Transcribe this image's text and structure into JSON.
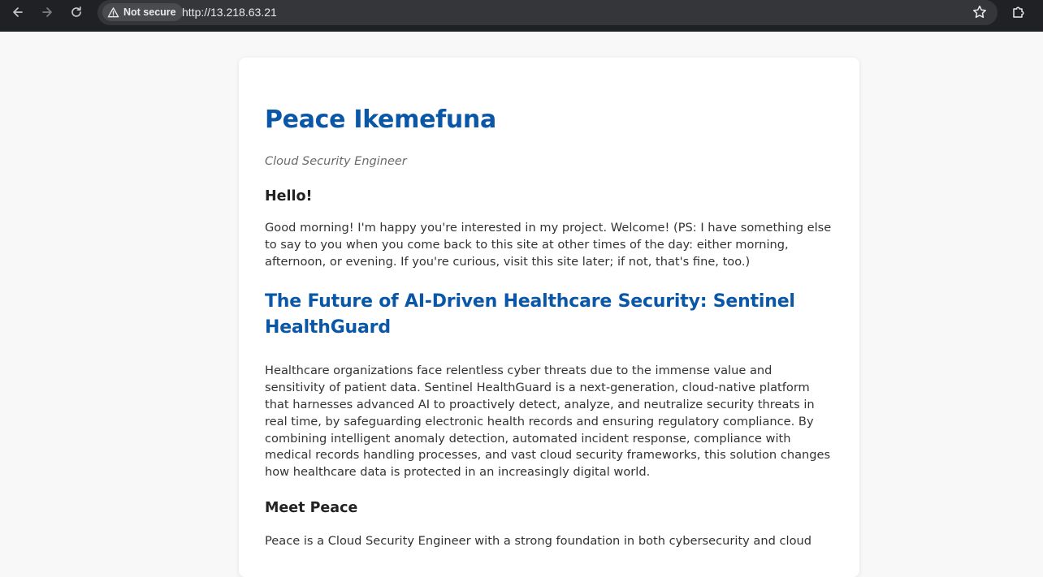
{
  "browser": {
    "security_label": "Not secure",
    "url": "http://13.218.63.21"
  },
  "page": {
    "name": "Peace Ikemefuna",
    "role": "Cloud Security Engineer",
    "hello_heading": "Hello!",
    "greeting": "Good morning! I'm happy you're interested in my project. Welcome! (PS: I have something else to say to you when you come back to this site at other times of the day: either morning, afternoon, or evening. If you're curious, visit this site later; if not, that's fine, too.)",
    "project_title": "The Future of AI-Driven Healthcare Security: Sentinel HealthGuard",
    "project_description": "Healthcare organizations face relentless cyber threats due to the immense value and sensitivity of patient data. Sentinel HealthGuard is a next-generation, cloud-native platform that harnesses advanced AI to proactively detect, analyze, and neutralize security threats in real time, by safeguarding electronic health records and ensuring regulatory compliance. By combining intelligent anomaly detection, automated incident response, compliance with medical records handling processes, and vast cloud security frameworks, this solution changes how healthcare data is protected in an increasingly digital world.",
    "meet_heading": "Meet Peace",
    "bio_start": "Peace is a Cloud Security Engineer with a strong foundation in both cybersecurity and cloud"
  },
  "colors": {
    "heading_blue": "#0a57a8",
    "chrome_bg": "#202124",
    "page_bg": "#f8f8f8"
  },
  "icons": [
    "back-arrow-icon",
    "forward-arrow-icon",
    "reload-icon",
    "warning-triangle-icon",
    "star-icon",
    "extensions-puzzle-icon"
  ]
}
